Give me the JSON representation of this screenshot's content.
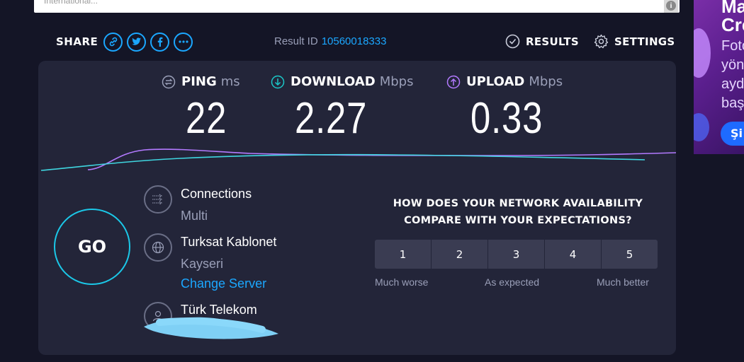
{
  "banner": {
    "text": "International..."
  },
  "share": {
    "label": "SHARE",
    "icons": [
      "link-icon",
      "twitter-icon",
      "facebook-icon",
      "more-icon"
    ]
  },
  "result": {
    "label": "Result ID",
    "id": "10560018333"
  },
  "nav": {
    "results": "RESULTS",
    "settings": "SETTINGS"
  },
  "metrics": {
    "ping": {
      "name": "PING",
      "unit": "ms",
      "value": "22",
      "color": "#9a9fb8"
    },
    "download": {
      "name": "DOWNLOAD",
      "unit": "Mbps",
      "value": "2.27",
      "color": "#1bc8c8"
    },
    "upload": {
      "name": "UPLOAD",
      "unit": "Mbps",
      "value": "0.33",
      "color": "#b37aff"
    }
  },
  "go": {
    "label": "GO"
  },
  "connection": {
    "connections_label": "Connections",
    "connections_value": "Multi",
    "server_name": "Turksat Kablonet",
    "server_location": "Kayseri",
    "change_server": "Change Server",
    "isp": "Türk Telekom"
  },
  "survey": {
    "question": "HOW DOES YOUR NETWORK AVAILABILITY COMPARE WITH YOUR EXPECTATIONS?",
    "options": [
      "1",
      "2",
      "3",
      "4",
      "5"
    ],
    "low_label": "Much worse",
    "mid_label": "As expected",
    "high_label": "Much better"
  },
  "ad": {
    "lines": [
      "Ma",
      "Cre",
      "Foto",
      "yön",
      "ayd",
      "başı"
    ],
    "button": "Şi"
  },
  "colors": {
    "accent": "#1ba7ff",
    "go_ring": "#1bc8e8",
    "upload": "#b37aff",
    "download": "#1bc8c8"
  }
}
